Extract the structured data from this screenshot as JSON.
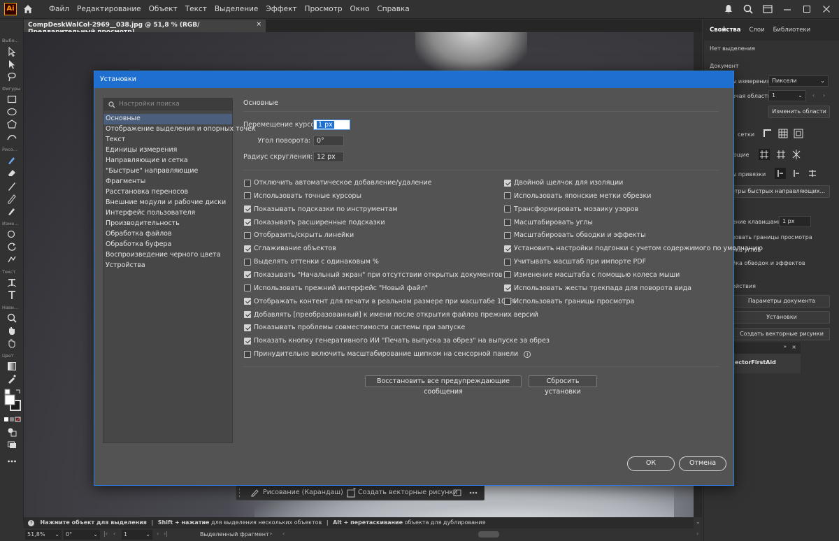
{
  "app": {
    "logo": "Ai",
    "menu": [
      "Файл",
      "Редактирование",
      "Объект",
      "Текст",
      "Выделение",
      "Эффект",
      "Просмотр",
      "Окно",
      "Справка"
    ]
  },
  "document_tab": {
    "title": "CompDeskWalCol-2969__038.jpg @ 51,8 % (RGB/Предварительный просмотр)",
    "close": "×"
  },
  "toolbar": {
    "labels": [
      "Выбо...",
      "Фигуры",
      "Рисо...",
      "Изме...",
      "Текст",
      "Нави...",
      "Цвет"
    ]
  },
  "right_panel": {
    "tabs": [
      "Свойства",
      "Слои",
      "Библиотеки"
    ],
    "no_selection": "Нет выделения",
    "document": "Документ",
    "units_label": "ы измерения:",
    "units_value": "Пиксели",
    "artboard_label": "очая область:",
    "artboard_value": "1",
    "edit_artboards": "Изменить области",
    "grid": "сетки",
    "guides": "ющие",
    "snap": "ы привязки",
    "smart_guides_params": "метры быстрых направляющих...",
    "keyboard_increment_label": "ение клавишами:",
    "keyboard_increment_value": "1 px",
    "preview_bounds": "зовать границы просмотра",
    "scale_corners": "йка углов",
    "scale_strokes": "йка обводок и эффектов",
    "quick_actions": "ействия",
    "doc_settings": "Параметры документа",
    "preferences": "Установки",
    "create_vector": "Создать векторные рисунки",
    "plugin": "ectorFirstAid"
  },
  "dialog": {
    "title": "Установки",
    "search_placeholder": "Настройки поиска",
    "categories": [
      "Основные",
      "Отображение выделения и опорных точек",
      "Текст",
      "Единицы измерения",
      "Направляющие и сетка",
      "\"Быстрые\" направляющие",
      "Фрагменты",
      "Расстановка переносов",
      "Внешние модули и рабочие диски",
      "Интерфейс пользователя",
      "Производительность",
      "Обработка файлов",
      "Обработка буфера",
      "Воспроизведение черного цвета",
      "Устройства"
    ],
    "selected_category": "Основные",
    "section_title": "Основные",
    "fields": {
      "keyboard_increment_label": "Перемещение курсора:",
      "keyboard_increment_value": "1 px",
      "constrain_angle_label": "Угол поворота:",
      "constrain_angle_value": "0°",
      "corner_radius_label": "Радиус скругления:",
      "corner_radius_value": "12 px"
    },
    "checkboxes_left": [
      {
        "label": "Отключить автоматическое добавление/удаление",
        "checked": false
      },
      {
        "label": "Использовать точные курсоры",
        "checked": false
      },
      {
        "label": "Показывать подсказки по инструментам",
        "checked": true
      },
      {
        "label": "Показывать расширенные подсказки",
        "checked": true
      },
      {
        "label": "Отобразить/скрыть линейки",
        "checked": false
      },
      {
        "label": "Сглаживание объектов",
        "checked": true
      },
      {
        "label": "Выделять оттенки с одинаковым %",
        "checked": false
      },
      {
        "label": "Показывать \"Начальный экран\" при отсутствии открытых документов",
        "checked": true
      },
      {
        "label": "Использовать прежний интерфейс \"Новый файл\"",
        "checked": false
      },
      {
        "label": "Отображать контент для печати в реальном размере при масштабе 100%",
        "checked": true
      },
      {
        "label": "Добавлять [преобразованный] к имени после открытия файлов прежних версий",
        "checked": true
      },
      {
        "label": "Показывать проблемы совместимости системы при запуске",
        "checked": true
      },
      {
        "label": "Показать кнопку генеративного ИИ \"Печать выпуска за обрез\" на выпуске за обрез",
        "checked": true
      },
      {
        "label": "Принудительно включить масштабирование щипком на сенсорной панели",
        "checked": false
      }
    ],
    "checkboxes_right": [
      {
        "label": "Двойной щелчок для изоляции",
        "checked": true
      },
      {
        "label": "Использовать японские метки обрезки",
        "checked": false
      },
      {
        "label": "Трансформировать мозаику узоров",
        "checked": false
      },
      {
        "label": "Масштабировать углы",
        "checked": false
      },
      {
        "label": "Масштабировать обводки и эффекты",
        "checked": false
      },
      {
        "label": "Установить настройки подгонки с учетом содержимого по умолчанию",
        "checked": true
      },
      {
        "label": "Учитывать масштаб при импорте PDF",
        "checked": false
      },
      {
        "label": "Изменение масштаба с помощью колеса мыши",
        "checked": false
      },
      {
        "label": "Использовать жесты трекпада для поворота вида",
        "checked": true
      },
      {
        "label": "Использовать границы просмотра",
        "checked": false
      }
    ],
    "reset_warnings": "Восстановить все предупреждающие сообщения",
    "reset_prefs": "Сбросить установки",
    "ok": "ОК",
    "cancel": "Отмена"
  },
  "floatbar": {
    "draw_mode": "Рисование (Карандаш)",
    "create_vector": "Создать векторные рисунки"
  },
  "statusbar": {
    "hint_1_bold": "Нажмите объект для выделения",
    "sep": "|",
    "hint_2_bold": "Shift + нажатие",
    "hint_2": "для выделения нескольких объектов",
    "hint_3_bold": "Alt + перетаскивание",
    "hint_3": "объекта для дублирования",
    "zoom": "51,8%",
    "rotation": "0°",
    "artboard": "1",
    "status": "Выделенный фрагмент"
  }
}
